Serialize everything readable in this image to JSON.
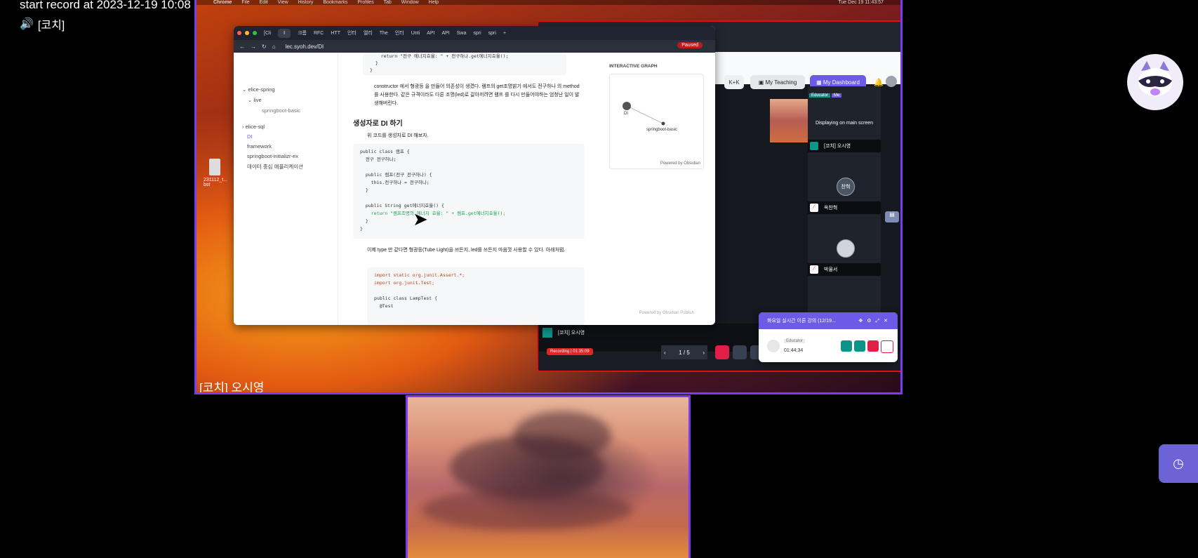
{
  "recording": {
    "title": "start record at 2023-12-19 10:08",
    "speaker_icon": "🔊",
    "speaker_name": "[코치]"
  },
  "main_tile": {
    "participant_name": "[코치] 오시영"
  },
  "mac_menubar": {
    "items": [
      "Chrome",
      "File",
      "Edit",
      "View",
      "History",
      "Bookmarks",
      "Profiles",
      "Tab",
      "Window",
      "Help"
    ],
    "clock": "Tue Dec 19 11:43:57"
  },
  "desktop": {
    "file_label": "231112_t... bst"
  },
  "browser": {
    "tabs": [
      "[Cli",
      "I",
      "크롬",
      "RFC",
      "HTT",
      "인터",
      "엘리",
      "The",
      "인터",
      "Unti",
      "API",
      "API",
      "Swa",
      "spri",
      "spri"
    ],
    "url": "lec.syoh.dev/DI",
    "paused": "Paused",
    "sidebar": {
      "items": [
        "elice-spring",
        "live",
        "springboot-basic",
        "elice-sql",
        "DI",
        "framework",
        "springboot-initializr-ex",
        "데이터 중심 애플리케이션"
      ]
    },
    "content": {
      "top_code": [
        "    return \"전구 에너지효율: \" + 전구하나.get에너지효율();",
        "  }",
        "}"
      ],
      "bullet1": "constructor 에서 형광등 을 만들어 의존성이 생겼다. 램프의 get조명밝기 에서도 전구하나 의 method 를 사용한다. 같은 규격이라도 다른 조명(led)로 갈아끼려면 램프 를 다시 만들어야하는 엄청난 일이 발생해버린다.",
      "heading": "생성자로 DI 하기",
      "bullet2": "위 코드를 생성자로 DI 해보자.",
      "code_lines": [
        "public class 램프 {",
        "  전구 전구하나;",
        "",
        "  public 램프(전구 전구하나) {",
        "    this.전구하나 = 전구하나;",
        "  }",
        "",
        "  public String get에너지효율() {",
        "    return \"램프조명의 에너지 효율: \" + 램프.get에너지효율();",
        "  }",
        "}"
      ],
      "bullet3": "이제 type 만 같다면 형광등(Tube Light)을 쓰든지, led를 쓰든지 마음껏 사용할 수 있다. 아래처럼.",
      "code2_lines": [
        "import static org.junit.Assert.*;",
        "import org.junit.Test;",
        "",
        "public class LampTest {",
        "  @Test"
      ],
      "publish_footer": "Powered by Obsidian Publish"
    },
    "graph": {
      "title": "INTERACTIVE GRAPH",
      "node_a": "DI",
      "node_b": "springboot-basic",
      "footer": "Powered by Obsidian"
    }
  },
  "zoom": {
    "buttons": {
      "btn1": "K+K",
      "teaching": "My Teaching",
      "dashboard": "My Dashboard"
    },
    "roles": {
      "educator": "Educator",
      "me": "Me"
    },
    "main_screen_label": "Displaying on main screen",
    "participants": [
      {
        "name": "[코치] 오시영",
        "avatar": ""
      },
      {
        "name": "옥찬혁",
        "avatar": "찬혁"
      },
      {
        "name": "박물서",
        "avatar": ""
      }
    ],
    "self_label": "[코치] 오시영",
    "recording_badge": "Recording | 01:35:09",
    "page_indicator": "1 / 5"
  },
  "float_panel": {
    "title": "화요일 실시간 이론 강의 (12/19...",
    "role": "Educator",
    "time": "01:44:34"
  },
  "colors": {
    "accent": "#7a3cf0",
    "zoom_purple": "#6d5ae6",
    "recording_red": "#dc2626",
    "history_btn": "#6c63d6"
  },
  "icons": {
    "history": "clock-icon",
    "speaker": "speaker-icon",
    "mascot": "raccoon-mascot"
  }
}
